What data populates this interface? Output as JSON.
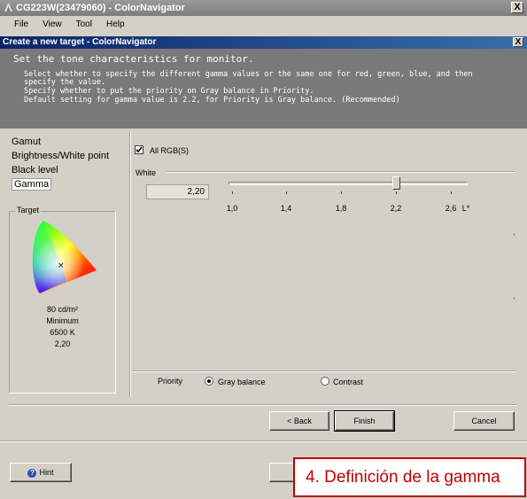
{
  "window": {
    "title": "CG223W(23479060) - ColorNavigator",
    "close_glyph": "X"
  },
  "menu": [
    "File",
    "View",
    "Tool",
    "Help"
  ],
  "dialog": {
    "title": "Create a new target - ColorNavigator",
    "close_glyph": "X"
  },
  "header": {
    "title": "Set the tone characteristics for monitor.",
    "lines": [
      "Select whether to specify the different gamma values or the same one for red, green, blue, and then",
      "specify the value.",
      "Specify whether to put the priority on Gray balance in Priority.",
      "Default setting for gamma value is 2.2, for Priority is Gray balance. (Recommended)"
    ]
  },
  "nav": {
    "items": [
      "Gamut",
      "Brightness/White point",
      "Black level",
      "Gamma"
    ],
    "active_index": 3
  },
  "target": {
    "legend": "Target",
    "values": [
      "80 cd/m²",
      "Minimum",
      "6500 K",
      "2,20"
    ]
  },
  "gamma": {
    "all_rgb_label": "All RGB(S)",
    "all_rgb_checked": true,
    "channel_label": "White",
    "value_text": "2,20",
    "slider": {
      "min": 1.0,
      "max": 2.6,
      "value": 2.2,
      "tick_labels": [
        "1,0",
        "1,4",
        "1,8",
        "2,2",
        "2,6"
      ],
      "unit_label": "L*"
    }
  },
  "priority": {
    "label": "Priority",
    "options": [
      "Gray balance",
      "Contrast"
    ],
    "selected": "Gray balance"
  },
  "buttons": {
    "back": "< Back",
    "finish": "Finish",
    "cancel": "Cancel",
    "hint": "Hint"
  },
  "caption": "4. Definición de la gamma",
  "colors": {
    "dialog_title": "#0a246a",
    "header_bg": "#797979",
    "caption_red": "#c00000"
  },
  "icons": [
    "app-icon",
    "close-icon",
    "checkmark-icon",
    "help-icon",
    "gamut-triangle-icon"
  ]
}
